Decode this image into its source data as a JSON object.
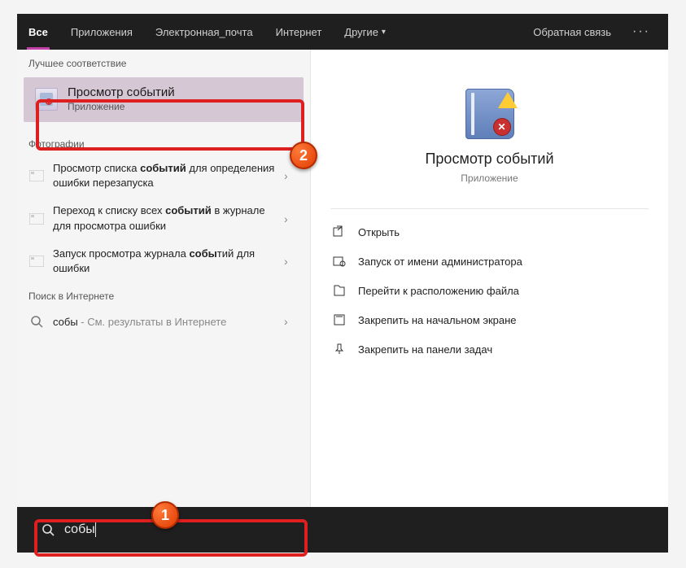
{
  "tabs": {
    "all": "Все",
    "apps": "Приложения",
    "email": "Электронная_почта",
    "internet": "Интернет",
    "more": "Другие"
  },
  "header": {
    "feedback": "Обратная связь"
  },
  "left": {
    "best_header": "Лучшее соответствие",
    "best": {
      "title": "Просмотр событий",
      "subtitle": "Приложение"
    },
    "photos_header": "Фотографии",
    "photos": [
      {
        "pre": "Просмотр списка ",
        "b": "событий",
        "post": " для определения ошибки перезапуска"
      },
      {
        "pre": "Переход к списку всех ",
        "b": "событий",
        "post": " в журнале для просмотра ошибки"
      },
      {
        "pre": "Запуск просмотра журнала ",
        "b": "собы",
        "post": "тий для ошибки"
      }
    ],
    "web_header": "Поиск в Интернете",
    "web": {
      "term": "собы",
      "trail": " - См. результаты в Интернете"
    }
  },
  "right": {
    "title": "Просмотр событий",
    "subtitle": "Приложение",
    "actions": [
      "Открыть",
      "Запуск от имени администратора",
      "Перейти к расположению файла",
      "Закрепить на начальном экране",
      "Закрепить на панели задач"
    ]
  },
  "search": {
    "query": "собы"
  },
  "steps": {
    "one": "1",
    "two": "2"
  }
}
